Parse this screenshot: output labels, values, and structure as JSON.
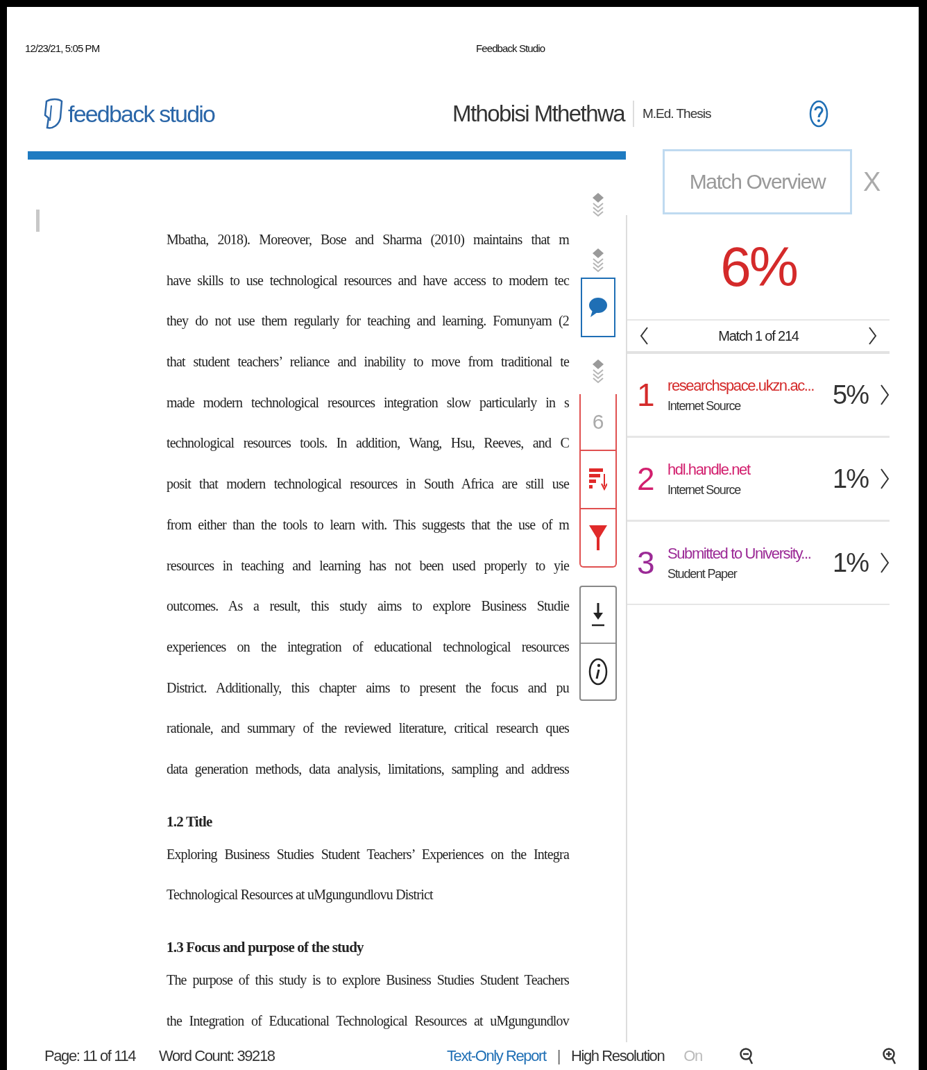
{
  "print_header": {
    "datetime": "12/23/21, 5:05 PM",
    "title": "Feedback Studio"
  },
  "header": {
    "logo_text": "feedback studio",
    "student": "Mthobisi Mthethwa",
    "assignment": "M.Ed. Thesis"
  },
  "document": {
    "paragraphs": [
      {
        "kind": "body",
        "last_line_ends": false,
        "lines": [
          "Mbatha, 2018). Moreover, Bose and Sharma (2010) maintains that m",
          "have skills to use technological resources and have access to modern tec",
          "they do not use them regularly for teaching and learning. Fomunyam (2",
          "that student teachers’ reliance and inability to move from traditional te",
          "made modern technological resources integration slow particularly in s",
          "technological resources tools. In addition, Wang, Hsu, Reeves, and C",
          "posit that modern technological resources in South Africa are still use",
          "from either than the tools to learn with. This suggests that the use of m",
          "resources in teaching and learning has not been used properly to yie",
          "outcomes. As a result, this study aims to explore Business Studie",
          "experiences on the integration of educational technological resources",
          "District. Additionally, this chapter aims to present the focus and pu",
          "rationale, and summary of the reviewed literature, critical research ques",
          "data generation methods, data analysis, limitations, sampling and address"
        ]
      },
      {
        "kind": "heading",
        "lines": [
          "1.2 Title"
        ]
      },
      {
        "kind": "body",
        "last_line_ends": true,
        "lines": [
          "Exploring Business Studies Student Teachers’ Experiences on the Integra",
          "Technological Resources at uMgungundlovu District"
        ]
      },
      {
        "kind": "heading",
        "lines": [
          "1.3 Focus and purpose of the study"
        ]
      },
      {
        "kind": "body",
        "last_line_ends": false,
        "lines": [
          "The purpose of this study is to explore Business Studies Student Teachers",
          "the Integration of Educational Technological Resources at uMgungundlov"
        ]
      }
    ]
  },
  "toolbar": {
    "comment_selected": true,
    "match_count": "6"
  },
  "match_panel": {
    "button": "Match Overview",
    "close": "X",
    "score": "6%",
    "nav": "Match 1 of 214",
    "matches": [
      {
        "number": "1",
        "source": "researchspace.ukzn.ac...",
        "type": "Internet Source",
        "percent": "5%",
        "color": "#d42a2a"
      },
      {
        "number": "2",
        "source": "hdl.handle.net",
        "type": "Internet Source",
        "percent": "1%",
        "color": "#d21f6e"
      },
      {
        "number": "3",
        "source": "Submitted to University...",
        "type": "Student Paper",
        "percent": "1%",
        "color": "#9b2a96"
      }
    ]
  },
  "footer": {
    "page": "Page: 11 of 114",
    "word_count": "Word Count: 39218",
    "report_link": "Text-Only Report",
    "separator": "|",
    "resolution_label": "High Resolution",
    "resolution_state": "On"
  }
}
